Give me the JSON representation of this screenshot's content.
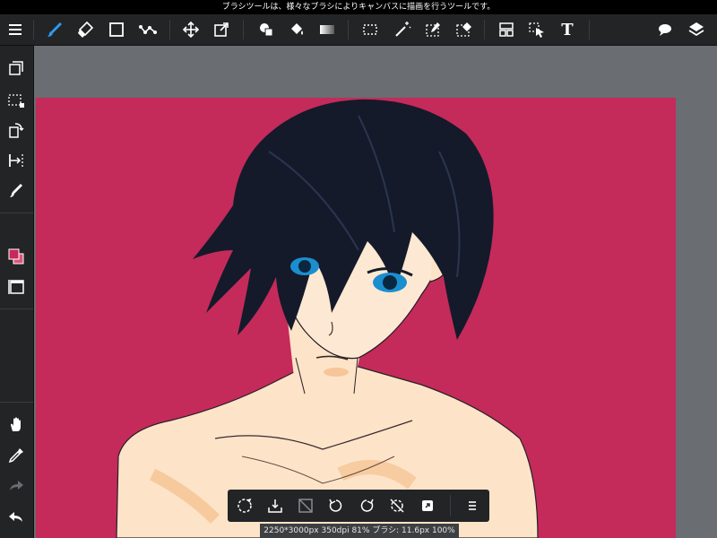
{
  "status_bar": {
    "message": "ブラシツールは、様々なブラシによりキャンバスに描画を行うツールです。"
  },
  "toolbar": {
    "menu_icon": "hamburger-icon",
    "items": [
      {
        "name": "brush-tool",
        "icon": "brush-icon",
        "active": true
      },
      {
        "name": "eraser-tool",
        "icon": "eraser-icon"
      },
      {
        "name": "shape-tool",
        "icon": "square-icon"
      },
      {
        "name": "dot-tool",
        "icon": "dot-brush-icon"
      },
      {
        "name": "move-tool",
        "icon": "move-icon"
      },
      {
        "name": "transform-tool",
        "icon": "transform-icon"
      },
      {
        "name": "fill-shape-tool",
        "icon": "fill-shape-icon"
      },
      {
        "name": "bucket-tool",
        "icon": "paint-bucket-icon"
      },
      {
        "name": "gradient-tool",
        "icon": "gradient-icon"
      },
      {
        "name": "select-tool",
        "icon": "marquee-icon"
      },
      {
        "name": "magic-wand-tool",
        "icon": "magic-wand-icon"
      },
      {
        "name": "select-pen-tool",
        "icon": "select-pen-icon"
      },
      {
        "name": "select-eraser-tool",
        "icon": "select-eraser-icon"
      },
      {
        "name": "frame-tool",
        "icon": "frame-icon"
      },
      {
        "name": "operation-tool",
        "icon": "cursor-select-icon"
      },
      {
        "name": "text-tool",
        "icon": "text-icon",
        "label": "T"
      },
      {
        "name": "comments",
        "icon": "speech-bubble-icon"
      },
      {
        "name": "layers",
        "icon": "layers-icon"
      }
    ]
  },
  "left_toolbar": {
    "items": [
      {
        "name": "layer-copy",
        "icon": "copy-layers-icon"
      },
      {
        "name": "selection",
        "icon": "selection-icon"
      },
      {
        "name": "rotate-canvas",
        "icon": "rotate-canvas-icon"
      },
      {
        "name": "snap",
        "icon": "snap-icon"
      },
      {
        "name": "brush-settings",
        "icon": "brush-small-icon"
      },
      {
        "name": "color-swatch",
        "icon": "color-swatch-icon"
      },
      {
        "name": "panel-toggle",
        "icon": "panel-icon"
      },
      {
        "name": "hand-tool",
        "icon": "hand-icon"
      },
      {
        "name": "eyedropper",
        "icon": "eyedropper-icon"
      },
      {
        "name": "redo",
        "icon": "redo-icon"
      },
      {
        "name": "undo",
        "icon": "undo-icon"
      }
    ]
  },
  "colors": {
    "main": "#c8285c",
    "sub": "#e0557a",
    "canvas_bg": "#c42b5a",
    "accent_brush": "#2e9bf2"
  },
  "bottom_toolbar": {
    "items": [
      {
        "name": "reset-view",
        "icon": "reset-view-icon"
      },
      {
        "name": "import",
        "icon": "import-icon"
      },
      {
        "name": "flip",
        "icon": "flip-icon"
      },
      {
        "name": "rotate-left",
        "icon": "rotate-ccw-icon"
      },
      {
        "name": "rotate-right",
        "icon": "rotate-cw-icon"
      },
      {
        "name": "reset-rotation",
        "icon": "no-rotate-icon"
      },
      {
        "name": "fullscreen",
        "icon": "fullscreen-icon"
      },
      {
        "name": "more",
        "icon": "hamburger-icon"
      }
    ]
  },
  "info_bar": {
    "text": "2250*3000px 350dpi 81% ブラシ: 11.6px 100%"
  }
}
